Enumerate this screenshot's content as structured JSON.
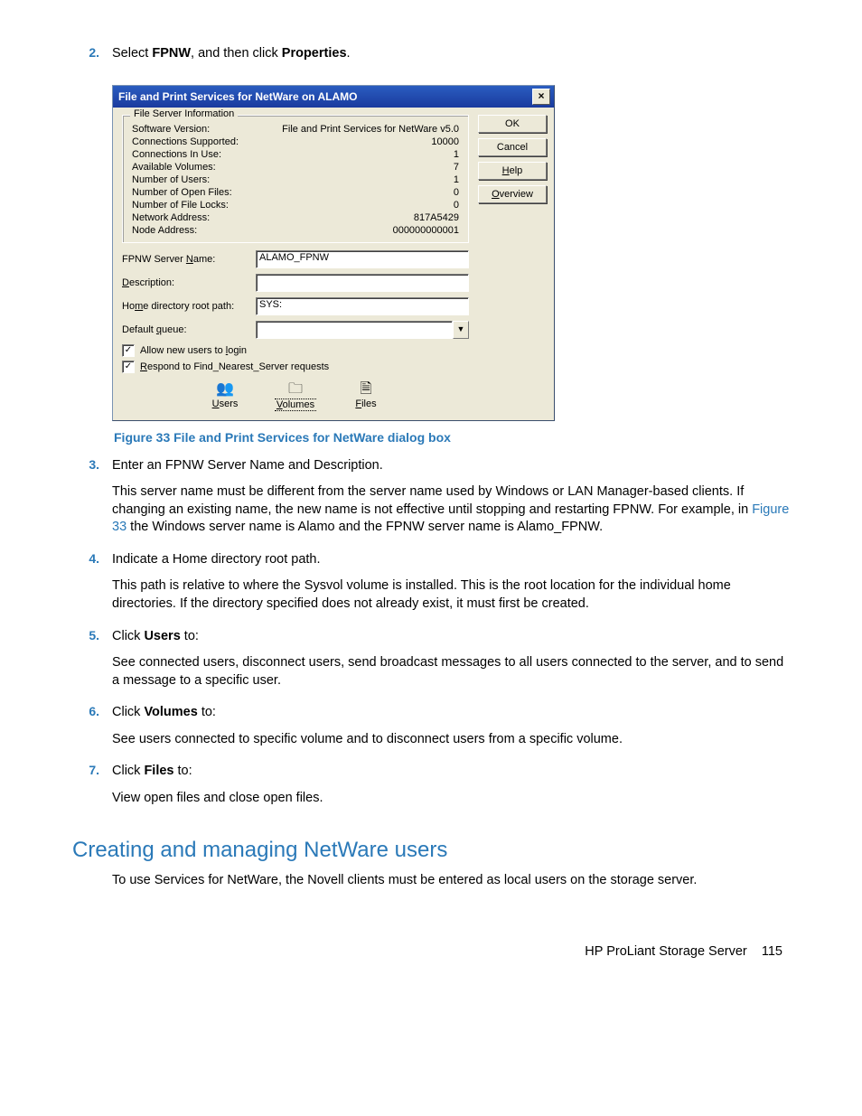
{
  "steps": {
    "s2": {
      "num": "2.",
      "text_a": "Select ",
      "bold_a": "FPNW",
      "text_b": ", and then click ",
      "bold_b": "Properties",
      "text_c": "."
    },
    "s3": {
      "num": "3.",
      "line1": "Enter an FPNW Server Name and Description.",
      "para_a": "This server name must be different from the server name used by Windows or LAN Manager-based clients. If changing an existing name, the new name is not effective until stopping and restarting FPNW. For example, in ",
      "link": "Figure 33",
      "para_b": " the Windows server name is Alamo and the FPNW server name is Alamo_FPNW."
    },
    "s4": {
      "num": "4.",
      "line1": "Indicate a Home directory root path.",
      "para": "This path is relative to where the Sysvol volume is installed. This is the root location for the individual home directories. If the directory specified does not already exist, it must first be created."
    },
    "s5": {
      "num": "5.",
      "text_a": "Click ",
      "bold": "Users",
      "text_b": " to:",
      "para": "See connected users, disconnect users, send broadcast messages to all users connected to the server, and to send a message to a specific user."
    },
    "s6": {
      "num": "6.",
      "text_a": "Click ",
      "bold": "Volumes",
      "text_b": " to:",
      "para": "See users connected to specific volume and to disconnect users from a specific volume."
    },
    "s7": {
      "num": "7.",
      "text_a": "Click ",
      "bold": "Files",
      "text_b": " to:",
      "para": "View open files and close open files."
    }
  },
  "figure_caption": "Figure 33 File and Print Services for NetWare dialog box",
  "dialog": {
    "title": "File and Print Services for NetWare on ALAMO",
    "close_glyph": "×",
    "buttons": {
      "ok": "OK",
      "cancel": "Cancel",
      "help": "Help",
      "overview": "Overview"
    },
    "group_label": "File Server Information",
    "info": [
      {
        "label": "Software Version:",
        "value": "File and Print Services for NetWare v5.0"
      },
      {
        "label": "Connections Supported:",
        "value": "10000"
      },
      {
        "label": "Connections In Use:",
        "value": "1"
      },
      {
        "label": "Available Volumes:",
        "value": "7"
      },
      {
        "label": "Number of Users:",
        "value": "1"
      },
      {
        "label": "Number of Open Files:",
        "value": "0"
      },
      {
        "label": "Number of File Locks:",
        "value": "0"
      },
      {
        "label": "Network Address:",
        "value": "817A5429"
      },
      {
        "label": "Node Address:",
        "value": "000000000001"
      }
    ],
    "form": {
      "server_name_label": "FPNW Server Name:",
      "server_name_value": "ALAMO_FPNW",
      "description_label": "Description:",
      "description_value": "",
      "home_label": "Home directory root path:",
      "home_value": "SYS:",
      "queue_label": "Default queue:",
      "queue_value": ""
    },
    "checks": {
      "allow": "Allow new users to login",
      "respond": "Respond to Find_Nearest_Server requests",
      "mark": "✓"
    },
    "iconbtns": {
      "users": "Users",
      "volumes": "Volumes",
      "files": "Files",
      "users_icon": "👥",
      "volumes_icon": "🗀",
      "files_icon": "🗎"
    }
  },
  "section_heading": "Creating and managing NetWare users",
  "section_body": "To use Services for NetWare, the Novell clients must be entered as local users on the storage server.",
  "footer": {
    "text": "HP ProLiant Storage Server",
    "page": "115"
  }
}
